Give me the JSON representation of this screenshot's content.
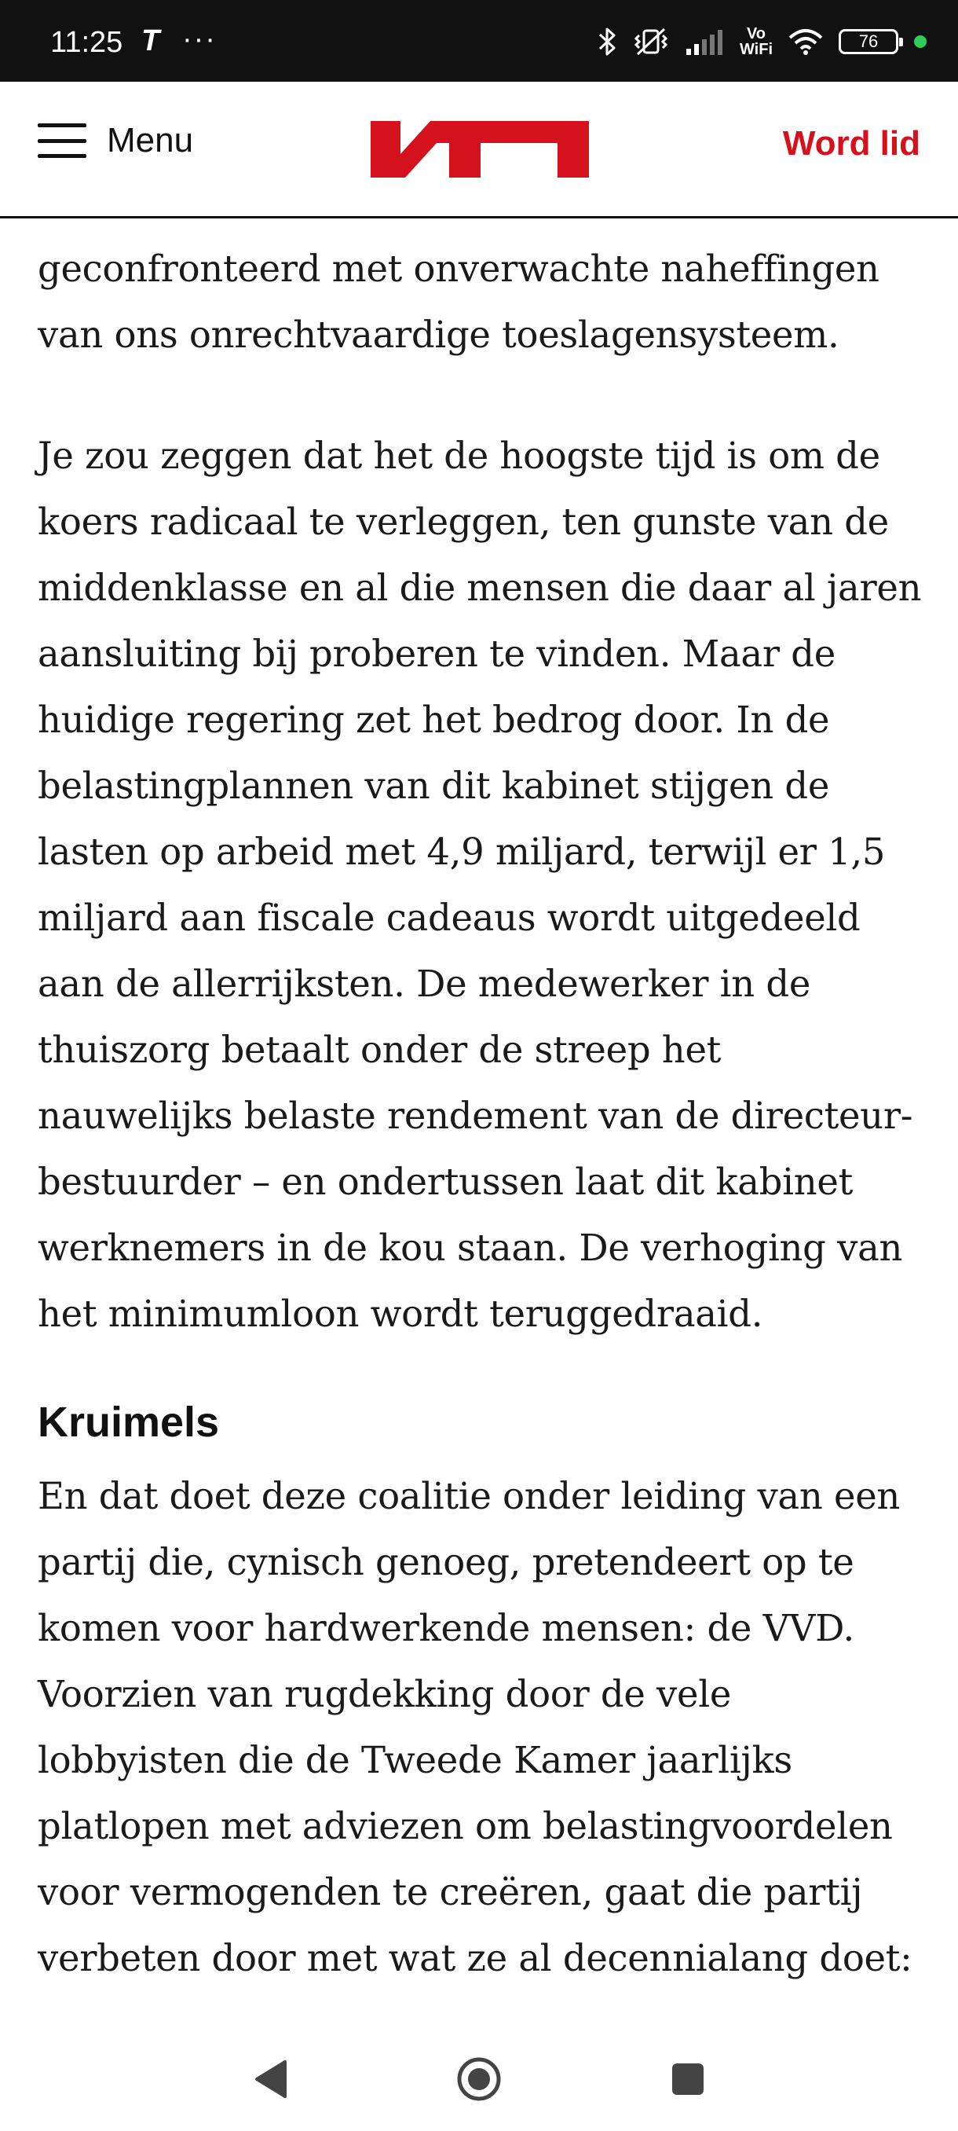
{
  "status_bar": {
    "time": "11:25",
    "app_icon": "T",
    "more": "···",
    "wifi_label_top": "Vo",
    "wifi_label_bottom": "WiFi",
    "battery_level": "76",
    "icons": [
      "bluetooth-icon",
      "vibrate-icon",
      "signal-icon",
      "vowifi-icon",
      "wifi-icon",
      "battery-icon",
      "privacy-dot-icon"
    ]
  },
  "header": {
    "menu_label": "Menu",
    "logo_icon": "sp-logo-icon",
    "join_label": "Word lid",
    "brand_color": "#d4111c"
  },
  "article": {
    "intro_paragraph": "geconfronteerd met onverwachte naheffingen van ons onrechtvaardige toeslagensysteem.",
    "main_paragraph": "Je zou zeggen dat het de hoogste tijd is om de koers radicaal te verleggen, ten gunste van de middenklasse en al die mensen die daar al jaren aansluiting bij proberen te vinden. Maar de huidige regering zet het bedrog door. In de belastingplannen van dit kabinet stijgen de lasten op arbeid met 4,9 miljard, terwijl er 1,5 miljard aan fiscale cadeaus wordt uitgedeeld aan de allerrijksten. De medewerker in de thuiszorg betaalt onder de streep het nauwelijks belaste rendement van de directeur-bestuurder – en ondertussen laat dit kabinet werknemers in de kou staan. De verhoging van het minimumloon wordt teruggedraaid.",
    "heading": "Kruimels",
    "last_paragraph": "En dat doet deze coalitie onder leiding van een partij die, cynisch genoeg, pretendeert op te komen voor hardwerkende mensen: de VVD. Voorzien van rugdekking door de vele lobbyisten die de Tweede Kamer jaarlijks platlopen met adviezen om belastingvoordelen voor vermogenden te creëren, gaat die partij verbeten door met wat ze al decennialang doet:"
  },
  "nav_bar": {
    "icons": [
      "back-icon",
      "home-icon",
      "recents-icon"
    ]
  }
}
